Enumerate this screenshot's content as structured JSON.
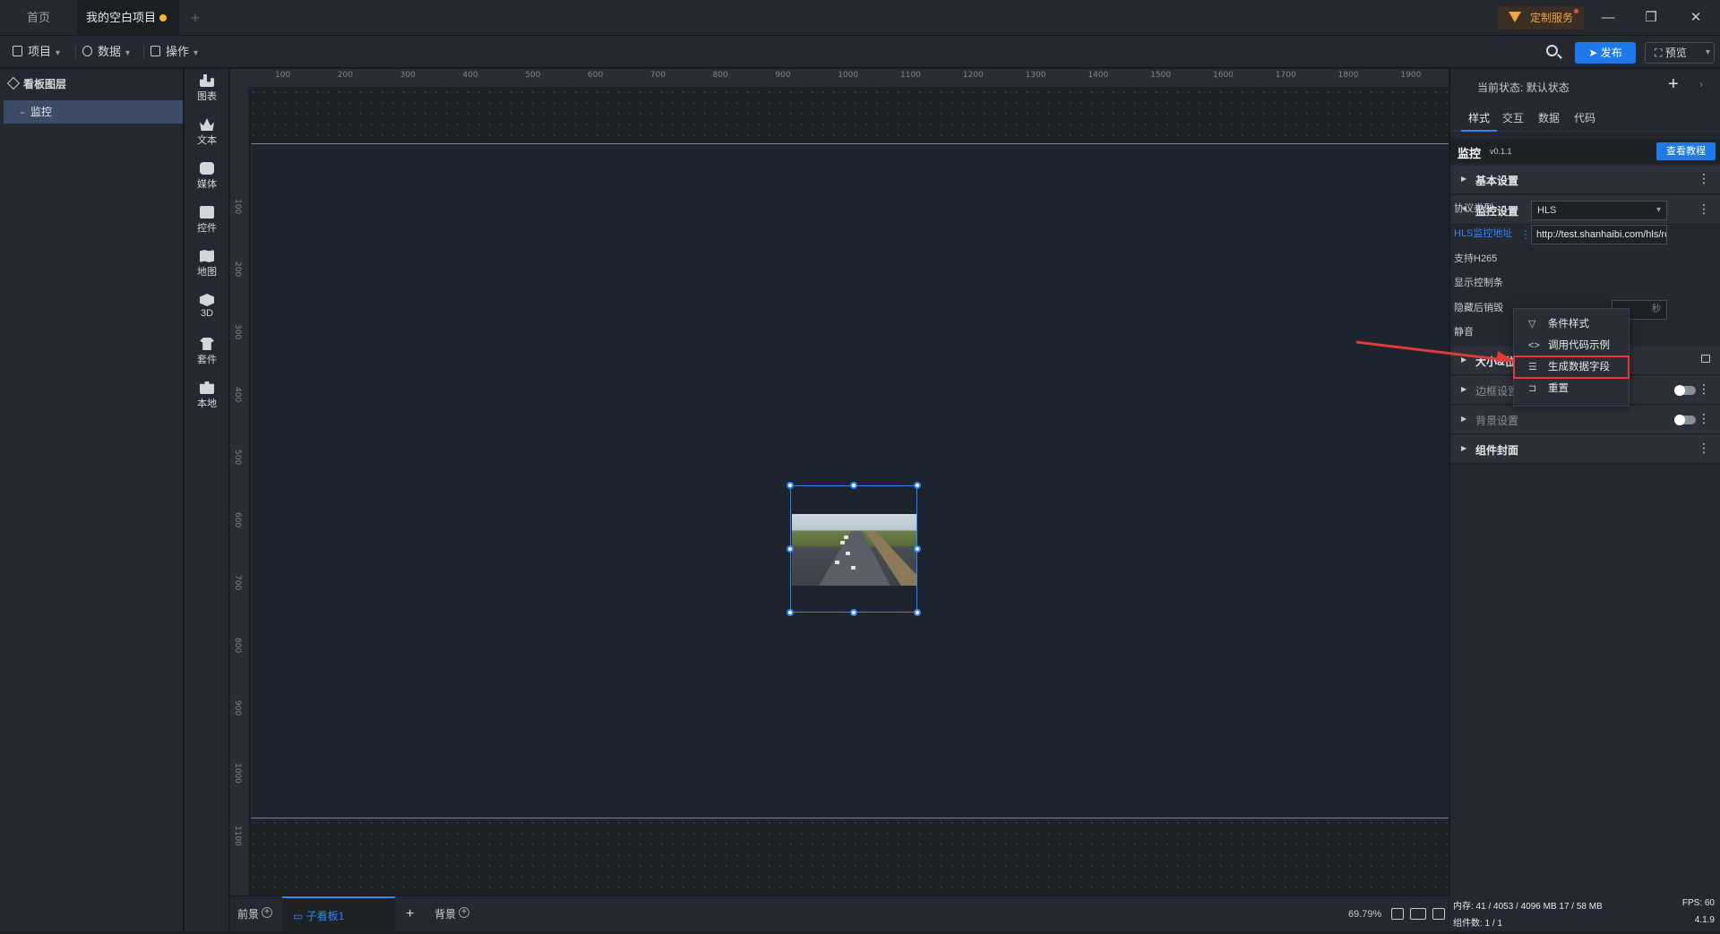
{
  "tabs": {
    "home": "首页",
    "project": "我的空白项目",
    "custom_service": "定制服务"
  },
  "toolbar": {
    "project": "项目",
    "data": "数据",
    "operate": "操作",
    "publish": "发布",
    "preview": "预览"
  },
  "layers": {
    "title": "看板图层",
    "items": [
      {
        "label": "监控"
      }
    ]
  },
  "components": [
    {
      "label": "图表",
      "icon": "bar-chart-icon"
    },
    {
      "label": "文本",
      "icon": "crown-icon"
    },
    {
      "label": "媒体",
      "icon": "media-icon"
    },
    {
      "label": "控件",
      "icon": "widget-icon"
    },
    {
      "label": "地图",
      "icon": "map-icon"
    },
    {
      "label": "3D",
      "icon": "cube-icon"
    },
    {
      "label": "套件",
      "icon": "shirt-icon"
    },
    {
      "label": "本地",
      "icon": "puzzle-icon"
    }
  ],
  "ruler": {
    "top": [
      "100",
      "200",
      "300",
      "400",
      "500",
      "600",
      "700",
      "800",
      "900",
      "1000",
      "1100",
      "1200",
      "1300",
      "1400",
      "1500",
      "1600",
      "1700",
      "1800",
      "1900"
    ],
    "left": [
      "100",
      "200",
      "300",
      "400",
      "500",
      "600",
      "700",
      "800",
      "900",
      "1000",
      "1100"
    ]
  },
  "bottom": {
    "foreground": "前景",
    "subboard": "子看板1",
    "background": "背景",
    "zoom": "69.79%"
  },
  "panel": {
    "state_label": "当前状态:",
    "state_value": "默认状态",
    "tabs": [
      "样式",
      "交互",
      "数据",
      "代码"
    ],
    "component_name": "监控",
    "component_version": "v0.1.1",
    "tutorial": "查看教程",
    "sections": {
      "basic": "基本设置",
      "monitor": "监控设置",
      "size_position": "大小&位置",
      "border": "边框设置",
      "background": "背景设置",
      "cover": "组件封面"
    },
    "fields": {
      "protocol_label": "协议类型",
      "protocol_value": "HLS",
      "hls_label": "HLS监控地址",
      "hls_value": "http://test.shanhaibi.com/hls/road",
      "h265_label": "支持H265",
      "controls_label": "显示控制条",
      "hide_label": "隐藏后销毁",
      "hide_unit": "秒",
      "mute_label": "静音"
    }
  },
  "context_menu": [
    {
      "label": "条件样式",
      "icon": "filter-icon"
    },
    {
      "label": "调用代码示例",
      "icon": "code-icon"
    },
    {
      "label": "生成数据字段",
      "icon": "database-icon",
      "highlighted": true
    },
    {
      "label": "重置",
      "icon": "reset-icon"
    }
  ],
  "status": {
    "memory": "内存: 41 / 4053 / 4096 MB  17 / 58 MB",
    "fps": "FPS: 60",
    "count": "组件数: 1 / 1",
    "version": "4.1.9"
  },
  "colors": {
    "accent": "#1e7ae8",
    "highlight_red": "#e03a3a",
    "unsaved_dot": "#f4b73e"
  }
}
